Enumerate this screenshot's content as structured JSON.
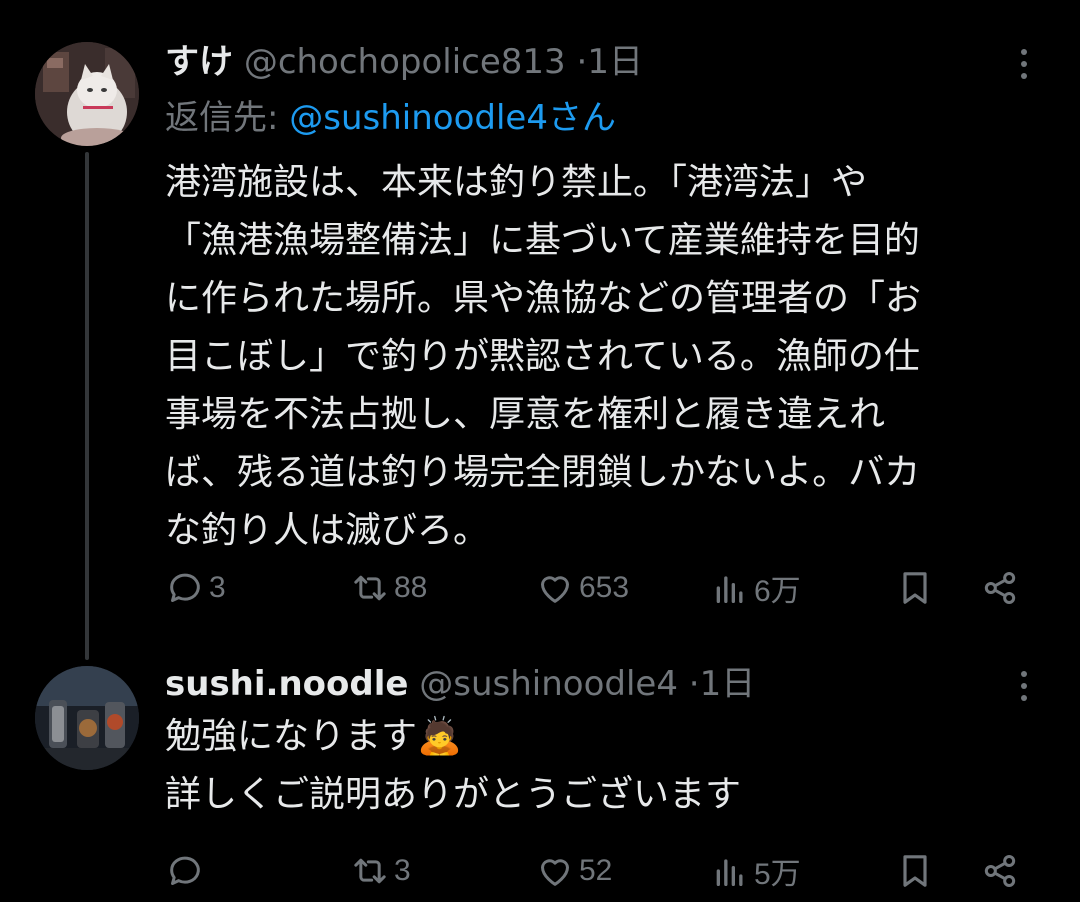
{
  "thread": [
    {
      "display_name": "すけ",
      "handle": "@chochopolice813",
      "separator": "·",
      "time": "1日",
      "reply_prefix": "返信先: ",
      "reply_to": "@sushinoodle4さん",
      "lines": [
        "港湾施設は、本来は釣り禁止。「港湾法」や",
        "「漁港漁場整備法」に基づいて産業維持を目的",
        "に作られた場所。県や漁協などの管理者の「お",
        "目こぼし」で釣りが黙認されている。漁師の仕",
        "事場を不法占拠し、厚意を権利と履き違えれ",
        "ば、残る道は釣り場完全閉鎖しかないよ。バカ",
        "な釣り人は滅びろ。"
      ],
      "stats": {
        "replies": "3",
        "reposts": "88",
        "likes": "653",
        "views": "6万"
      }
    },
    {
      "display_name": "sushi.noodle",
      "handle": "@sushinoodle4",
      "separator": "·",
      "time": "1日",
      "lines": [
        "勉強になります🙇",
        "詳しくご説明ありがとうございます"
      ],
      "stats": {
        "replies": "",
        "reposts": "3",
        "likes": "52",
        "views": "5万"
      }
    }
  ],
  "icons": {
    "reply": "speech-bubble-icon",
    "repost": "repost-arrows-icon",
    "like": "heart-icon",
    "views": "bar-chart-icon",
    "bookmark": "bookmark-icon",
    "share": "share-icon",
    "more": "vertical-ellipsis-icon"
  },
  "colors": {
    "background": "#000000",
    "text": "#e7e9ea",
    "muted": "#71767b",
    "link": "#1d9bf0",
    "thread_line": "#333639"
  }
}
